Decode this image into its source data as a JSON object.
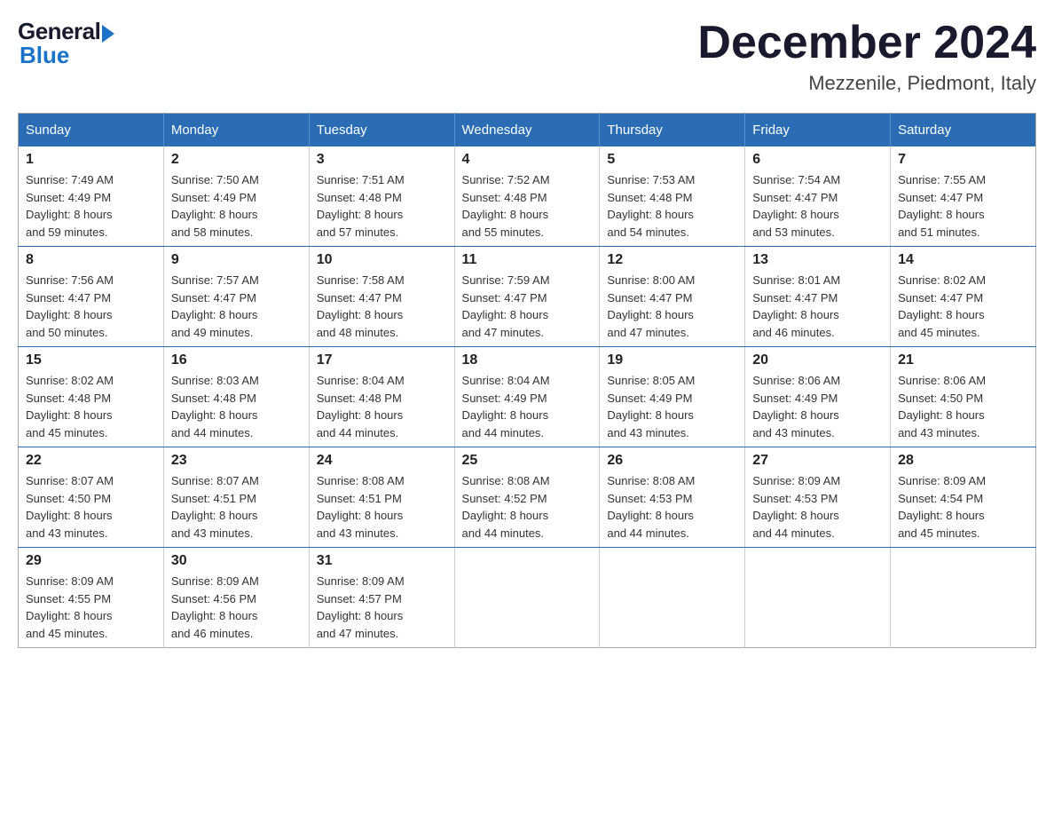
{
  "header": {
    "logo": {
      "general": "General",
      "blue": "Blue"
    },
    "title": "December 2024",
    "location": "Mezzenile, Piedmont, Italy"
  },
  "weekdays": [
    "Sunday",
    "Monday",
    "Tuesday",
    "Wednesday",
    "Thursday",
    "Friday",
    "Saturday"
  ],
  "weeks": [
    [
      {
        "day": "1",
        "sunrise": "7:49 AM",
        "sunset": "4:49 PM",
        "daylight": "8 hours and 59 minutes."
      },
      {
        "day": "2",
        "sunrise": "7:50 AM",
        "sunset": "4:49 PM",
        "daylight": "8 hours and 58 minutes."
      },
      {
        "day": "3",
        "sunrise": "7:51 AM",
        "sunset": "4:48 PM",
        "daylight": "8 hours and 57 minutes."
      },
      {
        "day": "4",
        "sunrise": "7:52 AM",
        "sunset": "4:48 PM",
        "daylight": "8 hours and 55 minutes."
      },
      {
        "day": "5",
        "sunrise": "7:53 AM",
        "sunset": "4:48 PM",
        "daylight": "8 hours and 54 minutes."
      },
      {
        "day": "6",
        "sunrise": "7:54 AM",
        "sunset": "4:47 PM",
        "daylight": "8 hours and 53 minutes."
      },
      {
        "day": "7",
        "sunrise": "7:55 AM",
        "sunset": "4:47 PM",
        "daylight": "8 hours and 51 minutes."
      }
    ],
    [
      {
        "day": "8",
        "sunrise": "7:56 AM",
        "sunset": "4:47 PM",
        "daylight": "8 hours and 50 minutes."
      },
      {
        "day": "9",
        "sunrise": "7:57 AM",
        "sunset": "4:47 PM",
        "daylight": "8 hours and 49 minutes."
      },
      {
        "day": "10",
        "sunrise": "7:58 AM",
        "sunset": "4:47 PM",
        "daylight": "8 hours and 48 minutes."
      },
      {
        "day": "11",
        "sunrise": "7:59 AM",
        "sunset": "4:47 PM",
        "daylight": "8 hours and 47 minutes."
      },
      {
        "day": "12",
        "sunrise": "8:00 AM",
        "sunset": "4:47 PM",
        "daylight": "8 hours and 47 minutes."
      },
      {
        "day": "13",
        "sunrise": "8:01 AM",
        "sunset": "4:47 PM",
        "daylight": "8 hours and 46 minutes."
      },
      {
        "day": "14",
        "sunrise": "8:02 AM",
        "sunset": "4:47 PM",
        "daylight": "8 hours and 45 minutes."
      }
    ],
    [
      {
        "day": "15",
        "sunrise": "8:02 AM",
        "sunset": "4:48 PM",
        "daylight": "8 hours and 45 minutes."
      },
      {
        "day": "16",
        "sunrise": "8:03 AM",
        "sunset": "4:48 PM",
        "daylight": "8 hours and 44 minutes."
      },
      {
        "day": "17",
        "sunrise": "8:04 AM",
        "sunset": "4:48 PM",
        "daylight": "8 hours and 44 minutes."
      },
      {
        "day": "18",
        "sunrise": "8:04 AM",
        "sunset": "4:49 PM",
        "daylight": "8 hours and 44 minutes."
      },
      {
        "day": "19",
        "sunrise": "8:05 AM",
        "sunset": "4:49 PM",
        "daylight": "8 hours and 43 minutes."
      },
      {
        "day": "20",
        "sunrise": "8:06 AM",
        "sunset": "4:49 PM",
        "daylight": "8 hours and 43 minutes."
      },
      {
        "day": "21",
        "sunrise": "8:06 AM",
        "sunset": "4:50 PM",
        "daylight": "8 hours and 43 minutes."
      }
    ],
    [
      {
        "day": "22",
        "sunrise": "8:07 AM",
        "sunset": "4:50 PM",
        "daylight": "8 hours and 43 minutes."
      },
      {
        "day": "23",
        "sunrise": "8:07 AM",
        "sunset": "4:51 PM",
        "daylight": "8 hours and 43 minutes."
      },
      {
        "day": "24",
        "sunrise": "8:08 AM",
        "sunset": "4:51 PM",
        "daylight": "8 hours and 43 minutes."
      },
      {
        "day": "25",
        "sunrise": "8:08 AM",
        "sunset": "4:52 PM",
        "daylight": "8 hours and 44 minutes."
      },
      {
        "day": "26",
        "sunrise": "8:08 AM",
        "sunset": "4:53 PM",
        "daylight": "8 hours and 44 minutes."
      },
      {
        "day": "27",
        "sunrise": "8:09 AM",
        "sunset": "4:53 PM",
        "daylight": "8 hours and 44 minutes."
      },
      {
        "day": "28",
        "sunrise": "8:09 AM",
        "sunset": "4:54 PM",
        "daylight": "8 hours and 45 minutes."
      }
    ],
    [
      {
        "day": "29",
        "sunrise": "8:09 AM",
        "sunset": "4:55 PM",
        "daylight": "8 hours and 45 minutes."
      },
      {
        "day": "30",
        "sunrise": "8:09 AM",
        "sunset": "4:56 PM",
        "daylight": "8 hours and 46 minutes."
      },
      {
        "day": "31",
        "sunrise": "8:09 AM",
        "sunset": "4:57 PM",
        "daylight": "8 hours and 47 minutes."
      },
      null,
      null,
      null,
      null
    ]
  ],
  "labels": {
    "sunrise": "Sunrise:",
    "sunset": "Sunset:",
    "daylight": "Daylight:"
  }
}
